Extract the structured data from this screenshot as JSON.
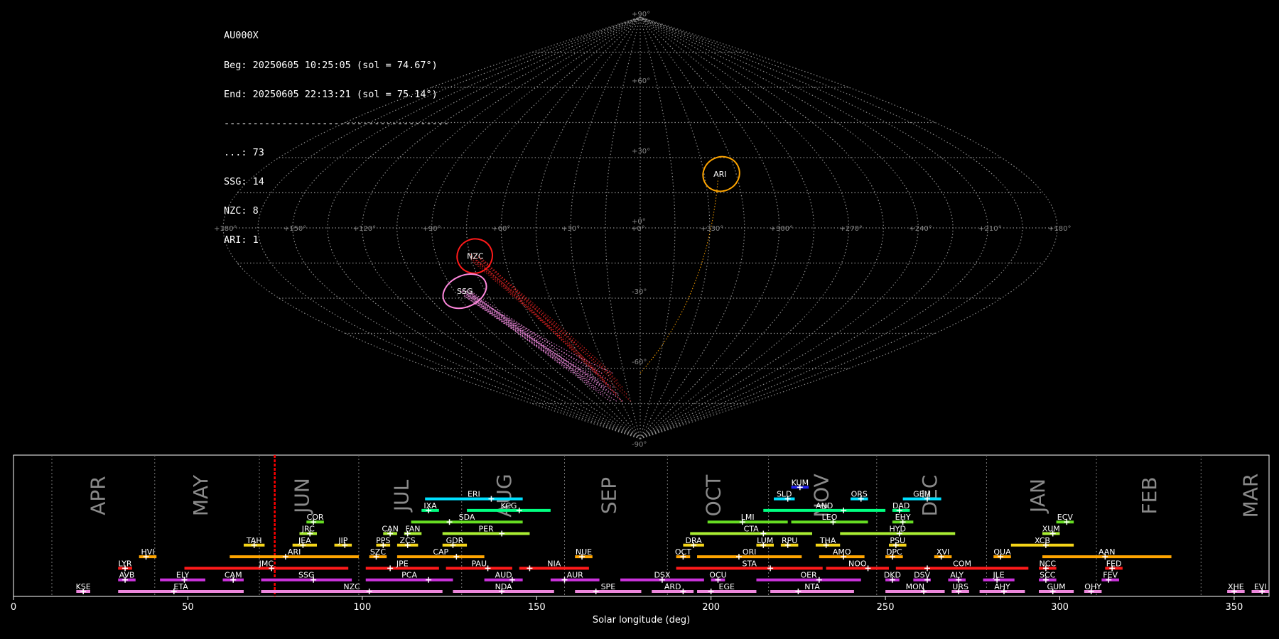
{
  "stats": {
    "lines": [
      "AU000X",
      "Beg: 20250605 10:25:05 (sol = 74.67°)",
      "End: 20250605 22:13:21 (sol = 75.14°)",
      "---------------------------------------",
      "...: 73",
      "SSG: 14",
      "NZC: 8",
      "ARI: 1"
    ]
  },
  "sky": {
    "lat_labels": [
      "+90°",
      "+60°",
      "+30°",
      "+0°",
      "-30°",
      "-60°",
      "-90°"
    ],
    "lon_labels": [
      "+180°",
      "+150°",
      "+120°",
      "+90°",
      "+60°",
      "+30°",
      "+0°",
      "+330°",
      "+300°",
      "+270°",
      "+240°",
      "+210°",
      "+180°"
    ],
    "radiants": [
      {
        "name": "ARI",
        "color": "#ffa500",
        "lon": 38,
        "lat": 23,
        "rx": 26,
        "ry": 24
      },
      {
        "name": "NZC",
        "color": "#ff1a1a",
        "lon": -73,
        "lat": -12,
        "rx": 25,
        "ry": 24
      },
      {
        "name": "SSG",
        "color": "#ff88dd",
        "lon": -85,
        "lat": -27,
        "rx": 32,
        "ry": 22
      }
    ],
    "colors": {
      "grid": "#8a8a8a",
      "background": "#000000"
    }
  },
  "chart_data": {
    "type": "timeline",
    "xlabel": "Solar longitude (deg)",
    "xlim": [
      0,
      360
    ],
    "xticks": [
      0,
      50,
      100,
      150,
      200,
      250,
      300,
      350
    ],
    "current_sol": 74.9,
    "current_sol_color": "#ff0000",
    "months": [
      {
        "name": "APR",
        "sol": 24.5
      },
      {
        "name": "MAY",
        "sol": 54
      },
      {
        "name": "JUN",
        "sol": 83
      },
      {
        "name": "JUL",
        "sol": 111.5
      },
      {
        "name": "AUG",
        "sol": 141
      },
      {
        "name": "SEP",
        "sol": 171
      },
      {
        "name": "OCT",
        "sol": 201
      },
      {
        "name": "NOV",
        "sol": 232
      },
      {
        "name": "DEC",
        "sol": 263
      },
      {
        "name": "JAN",
        "sol": 294
      },
      {
        "name": "FEB",
        "sol": 326
      },
      {
        "name": "MAR",
        "sol": 355
      }
    ],
    "month_boundaries": [
      11,
      40.5,
      70.5,
      99,
      128.5,
      158,
      187.5,
      216.5,
      247.5,
      279,
      310.5,
      340.5
    ],
    "showers": [
      {
        "name": "KUM",
        "s": 223,
        "e": 228,
        "peak": 225.5,
        "row": 9,
        "color": "#2222ee"
      },
      {
        "name": "ERI",
        "s": 118,
        "e": 146,
        "peak": 137,
        "row": 8,
        "color": "#00e0ff"
      },
      {
        "name": "SLD",
        "s": 218,
        "e": 224,
        "peak": 222,
        "row": 8,
        "color": "#00e0ff"
      },
      {
        "name": "ORS",
        "s": 240,
        "e": 245,
        "peak": 243,
        "row": 8,
        "color": "#00e0ff"
      },
      {
        "name": "GEM",
        "s": 255,
        "e": 266,
        "peak": 262,
        "row": 8,
        "color": "#00e0ff"
      },
      {
        "name": "IXA",
        "s": 117,
        "e": 122,
        "peak": 119,
        "row": 7,
        "color": "#00ff80"
      },
      {
        "name": "KCG",
        "s": 130,
        "e": 154,
        "peak": 145,
        "row": 7,
        "color": "#00ff80"
      },
      {
        "name": "AND",
        "s": 215,
        "e": 250,
        "peak": 238,
        "row": 7,
        "color": "#00ff80"
      },
      {
        "name": "DAD",
        "s": 252,
        "e": 257,
        "peak": 254,
        "row": 7,
        "color": "#00ff80"
      },
      {
        "name": "COR",
        "s": 84,
        "e": 89,
        "peak": 86,
        "row": 6,
        "color": "#66dd22"
      },
      {
        "name": "SDA",
        "s": 114,
        "e": 146,
        "peak": 125,
        "row": 6,
        "color": "#66dd22"
      },
      {
        "name": "LMI",
        "s": 199,
        "e": 222,
        "peak": 209,
        "row": 6,
        "color": "#66dd22"
      },
      {
        "name": "LEO",
        "s": 223,
        "e": 245,
        "peak": 235,
        "row": 6,
        "color": "#66dd22"
      },
      {
        "name": "EHY",
        "s": 252,
        "e": 258,
        "peak": 255,
        "row": 6,
        "color": "#66dd22"
      },
      {
        "name": "ECV",
        "s": 299,
        "e": 304,
        "peak": 302,
        "row": 6,
        "color": "#66dd22"
      },
      {
        "name": "JRC",
        "s": 82,
        "e": 87,
        "peak": 85,
        "row": 5,
        "color": "#aaee33"
      },
      {
        "name": "CAN",
        "s": 106,
        "e": 110,
        "peak": 108,
        "row": 5,
        "color": "#aaee33"
      },
      {
        "name": "FAN",
        "s": 112,
        "e": 117,
        "peak": 113,
        "row": 5,
        "color": "#aaee33"
      },
      {
        "name": "PER",
        "s": 123,
        "e": 148,
        "peak": 140,
        "row": 5,
        "color": "#aaee33"
      },
      {
        "name": "CTA",
        "s": 194,
        "e": 229,
        "peak": 215,
        "row": 5,
        "color": "#aaee33"
      },
      {
        "name": "HYD",
        "s": 237,
        "e": 270,
        "peak": 254,
        "row": 5,
        "color": "#aaee33"
      },
      {
        "name": "XUM",
        "s": 295,
        "e": 300,
        "peak": 298,
        "row": 5,
        "color": "#aaee33"
      },
      {
        "name": "TAH",
        "s": 66,
        "e": 72,
        "peak": 69,
        "row": 4,
        "color": "#f5d518"
      },
      {
        "name": "JEA",
        "s": 80,
        "e": 87,
        "peak": 83,
        "row": 4,
        "color": "#f5d518"
      },
      {
        "name": "JIP",
        "s": 92,
        "e": 97,
        "peak": 95,
        "row": 4,
        "color": "#f5d518"
      },
      {
        "name": "PPS",
        "s": 104,
        "e": 108,
        "peak": 106,
        "row": 4,
        "color": "#f5d518"
      },
      {
        "name": "ZCS",
        "s": 110,
        "e": 116,
        "peak": 113,
        "row": 4,
        "color": "#f5d518"
      },
      {
        "name": "GDR",
        "s": 123,
        "e": 130,
        "peak": 126,
        "row": 4,
        "color": "#f5d518"
      },
      {
        "name": "DRA",
        "s": 192,
        "e": 198,
        "peak": 195,
        "row": 4,
        "color": "#f5d518"
      },
      {
        "name": "LUM",
        "s": 213,
        "e": 218,
        "peak": 215,
        "row": 4,
        "color": "#f5d518"
      },
      {
        "name": "RPU",
        "s": 220,
        "e": 225,
        "peak": 222,
        "row": 4,
        "color": "#f5d518"
      },
      {
        "name": "THA",
        "s": 230,
        "e": 237,
        "peak": 233,
        "row": 4,
        "color": "#f5d518"
      },
      {
        "name": "PSU",
        "s": 251,
        "e": 256,
        "peak": 253,
        "row": 4,
        "color": "#f5d518"
      },
      {
        "name": "XCB",
        "s": 286,
        "e": 304,
        "peak": 296,
        "row": 4,
        "color": "#f5d518"
      },
      {
        "name": "HVI",
        "s": 36,
        "e": 41,
        "peak": 38,
        "row": 3,
        "color": "#ffa500"
      },
      {
        "name": "ARI",
        "s": 62,
        "e": 99,
        "peak": 78,
        "row": 3,
        "color": "#ffa500"
      },
      {
        "name": "SZC",
        "s": 102,
        "e": 107,
        "peak": 104,
        "row": 3,
        "color": "#ffa500"
      },
      {
        "name": "CAP",
        "s": 110,
        "e": 135,
        "peak": 127,
        "row": 3,
        "color": "#ffa500"
      },
      {
        "name": "NUE",
        "s": 161,
        "e": 166,
        "peak": 163,
        "row": 3,
        "color": "#ffa500"
      },
      {
        "name": "OCT",
        "s": 190,
        "e": 194,
        "peak": 192,
        "row": 3,
        "color": "#ffa500"
      },
      {
        "name": "ORI",
        "s": 196,
        "e": 226,
        "peak": 208,
        "row": 3,
        "color": "#ffa500"
      },
      {
        "name": "AMO",
        "s": 231,
        "e": 244,
        "peak": 238,
        "row": 3,
        "color": "#ffa500"
      },
      {
        "name": "DPC",
        "s": 250,
        "e": 255,
        "peak": 252,
        "row": 3,
        "color": "#ffa500"
      },
      {
        "name": "XVI",
        "s": 264,
        "e": 269,
        "peak": 266,
        "row": 3,
        "color": "#ffa500"
      },
      {
        "name": "QUA",
        "s": 281,
        "e": 286,
        "peak": 283,
        "row": 3,
        "color": "#ffa500"
      },
      {
        "name": "AAN",
        "s": 295,
        "e": 332,
        "peak": 313,
        "row": 3,
        "color": "#ffa500"
      },
      {
        "name": "LYR",
        "s": 30,
        "e": 34,
        "peak": 32,
        "row": 2,
        "color": "#ff1a1a"
      },
      {
        "name": "JMC",
        "s": 49,
        "e": 96,
        "peak": 74,
        "row": 2,
        "color": "#ff1a1a"
      },
      {
        "name": "JPE",
        "s": 101,
        "e": 122,
        "peak": 108,
        "row": 2,
        "color": "#ff1a1a"
      },
      {
        "name": "PAU",
        "s": 124,
        "e": 143,
        "peak": 136,
        "row": 2,
        "color": "#ff1a1a"
      },
      {
        "name": "NIA",
        "s": 145,
        "e": 165,
        "peak": 148,
        "row": 2,
        "color": "#ff1a1a"
      },
      {
        "name": "STA",
        "s": 190,
        "e": 232,
        "peak": 217,
        "row": 2,
        "color": "#ff1a1a"
      },
      {
        "name": "NOO",
        "s": 233,
        "e": 251,
        "peak": 245,
        "row": 2,
        "color": "#ff1a1a"
      },
      {
        "name": "COM",
        "s": 253,
        "e": 291,
        "peak": 262,
        "row": 2,
        "color": "#ff1a1a"
      },
      {
        "name": "NCC",
        "s": 294,
        "e": 299,
        "peak": 296,
        "row": 2,
        "color": "#ff1a1a"
      },
      {
        "name": "FED",
        "s": 313,
        "e": 318,
        "peak": 315,
        "row": 2,
        "color": "#ff1a1a"
      },
      {
        "name": "AVB",
        "s": 30,
        "e": 35,
        "peak": 32,
        "row": 1,
        "color": "#cc33dd"
      },
      {
        "name": "ELY",
        "s": 42,
        "e": 55,
        "peak": 49,
        "row": 1,
        "color": "#cc33dd"
      },
      {
        "name": "CAM",
        "s": 60,
        "e": 66,
        "peak": 63,
        "row": 1,
        "color": "#cc33dd"
      },
      {
        "name": "SSG",
        "s": 71,
        "e": 97,
        "peak": 86,
        "row": 1,
        "color": "#cc33dd"
      },
      {
        "name": "PCA",
        "s": 101,
        "e": 126,
        "peak": 119,
        "row": 1,
        "color": "#cc33dd"
      },
      {
        "name": "AUD",
        "s": 135,
        "e": 146,
        "peak": 143,
        "row": 1,
        "color": "#cc33dd"
      },
      {
        "name": "AUR",
        "s": 154,
        "e": 168,
        "peak": 158,
        "row": 1,
        "color": "#cc33dd"
      },
      {
        "name": "DSX",
        "s": 174,
        "e": 198,
        "peak": 186,
        "row": 1,
        "color": "#cc33dd"
      },
      {
        "name": "OCU",
        "s": 200,
        "e": 204,
        "peak": 202,
        "row": 1,
        "color": "#cc33dd"
      },
      {
        "name": "OER",
        "s": 213,
        "e": 243,
        "peak": 231,
        "row": 1,
        "color": "#cc33dd"
      },
      {
        "name": "DKD",
        "s": 250,
        "e": 254,
        "peak": 252,
        "row": 1,
        "color": "#cc33dd"
      },
      {
        "name": "DSV",
        "s": 258,
        "e": 263,
        "peak": 262,
        "row": 1,
        "color": "#cc33dd"
      },
      {
        "name": "ALY",
        "s": 268,
        "e": 273,
        "peak": 271,
        "row": 1,
        "color": "#cc33dd"
      },
      {
        "name": "JLE",
        "s": 278,
        "e": 287,
        "peak": 282,
        "row": 1,
        "color": "#cc33dd"
      },
      {
        "name": "SCC",
        "s": 294,
        "e": 299,
        "peak": 296,
        "row": 1,
        "color": "#cc33dd"
      },
      {
        "name": "FEV",
        "s": 312,
        "e": 317,
        "peak": 314,
        "row": 1,
        "color": "#cc33dd"
      },
      {
        "name": "KSE",
        "s": 18,
        "e": 22,
        "peak": 20,
        "row": 0,
        "color": "#ee88dd"
      },
      {
        "name": "ETA",
        "s": 30,
        "e": 66,
        "peak": 46,
        "row": 0,
        "color": "#ee88dd"
      },
      {
        "name": "NZC",
        "s": 71,
        "e": 123,
        "peak": 102,
        "row": 0,
        "color": "#ee88dd"
      },
      {
        "name": "NDA",
        "s": 126,
        "e": 155,
        "peak": 140,
        "row": 0,
        "color": "#ee88dd"
      },
      {
        "name": "SPE",
        "s": 161,
        "e": 180,
        "peak": 167,
        "row": 0,
        "color": "#ee88dd"
      },
      {
        "name": "ARD",
        "s": 183,
        "e": 195,
        "peak": 192,
        "row": 0,
        "color": "#ee88dd"
      },
      {
        "name": "EGE",
        "s": 196,
        "e": 213,
        "peak": 200,
        "row": 0,
        "color": "#ee88dd"
      },
      {
        "name": "NTA",
        "s": 217,
        "e": 241,
        "peak": 225,
        "row": 0,
        "color": "#ee88dd"
      },
      {
        "name": "MON",
        "s": 250,
        "e": 267,
        "peak": 261,
        "row": 0,
        "color": "#ee88dd"
      },
      {
        "name": "URS",
        "s": 269,
        "e": 274,
        "peak": 271,
        "row": 0,
        "color": "#ee88dd"
      },
      {
        "name": "AHY",
        "s": 277,
        "e": 290,
        "peak": 284,
        "row": 0,
        "color": "#ee88dd"
      },
      {
        "name": "GUM",
        "s": 294,
        "e": 304,
        "peak": 298,
        "row": 0,
        "color": "#ee88dd"
      },
      {
        "name": "OHY",
        "s": 307,
        "e": 312,
        "peak": 309,
        "row": 0,
        "color": "#ee88dd"
      },
      {
        "name": "XHE",
        "s": 348,
        "e": 353,
        "peak": 350,
        "row": 0,
        "color": "#ee88dd"
      },
      {
        "name": "EVI",
        "s": 355,
        "e": 360,
        "peak": 358,
        "row": 0,
        "color": "#ee88dd"
      }
    ]
  }
}
